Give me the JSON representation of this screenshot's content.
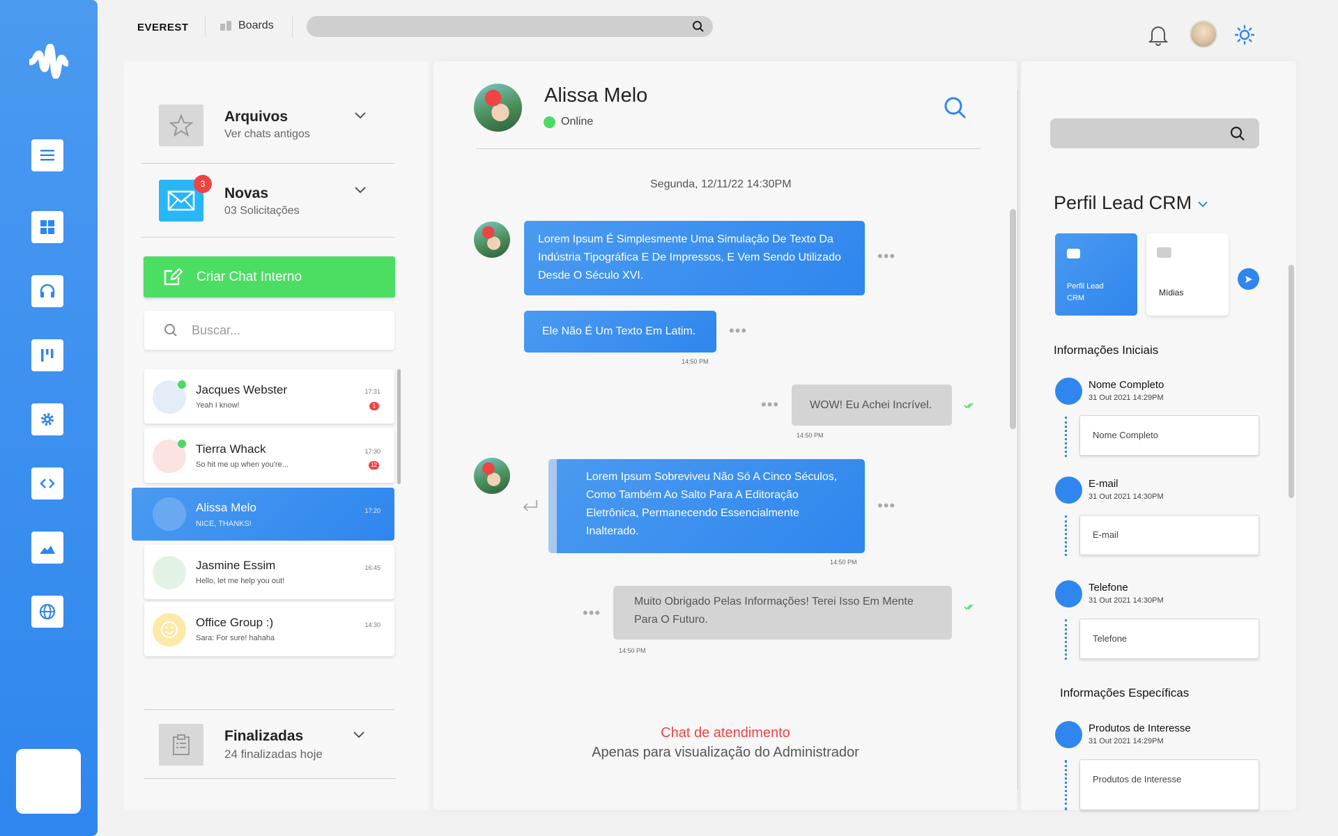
{
  "app": {
    "brand": "EVEREST",
    "boards_label": "Boards",
    "accent": "#2f86ee",
    "online_color": "#4cd964",
    "alert_color": "#ef4444",
    "create_color": "#4cdd63"
  },
  "rail": {
    "icons": [
      "menu-icon",
      "grid-icon",
      "headset-icon",
      "kanban-icon",
      "settings-icon",
      "code-icon",
      "image-icon",
      "globe-icon"
    ]
  },
  "sections": {
    "arquivos": {
      "title": "Arquivos",
      "subtitle": "Ver chats antigos"
    },
    "novas": {
      "title": "Novas",
      "subtitle": "03 Solicitações",
      "badge": "3"
    },
    "criar": {
      "label": "Criar Chat Interno"
    },
    "buscar": {
      "placeholder": "Buscar..."
    },
    "finalizadas": {
      "title": "Finalizadas",
      "subtitle": "24 finalizadas hoje"
    }
  },
  "chats": [
    {
      "name": "Jacques Webster",
      "preview": "Yeah I know!",
      "time": "17:31",
      "badge": "1"
    },
    {
      "name": "Tierra Whack",
      "preview": "So hit me up when you're...",
      "time": "17:30",
      "badge": "12"
    },
    {
      "name": "Alissa Melo",
      "preview": "NICE, THANKS!",
      "time": "17:20",
      "badge": ""
    },
    {
      "name": "Jasmine Essim",
      "preview": "Hello, let me help you out!",
      "time": "16:45",
      "badge": ""
    },
    {
      "name": "Office Group :)",
      "preview": "Sara: For sure! hahaha",
      "time": "14:30",
      "badge": ""
    }
  ],
  "conversation": {
    "contact": "Alissa Melo",
    "status": "Online",
    "date": "Segunda, 12/11/22 14:30PM",
    "messages": [
      {
        "text": "Lorem Ipsum É Simplesmente Uma Simulação De Texto Da Indústria Tipográfica E De Impressos, E Vem Sendo Utilizado Desde O Século XVI.",
        "time": ""
      },
      {
        "text": "Ele Não É Um Texto Em Latim.",
        "time": "14:50 PM"
      },
      {
        "text": "WOW! Eu Achei Incrível.",
        "time": "14:50 PM"
      },
      {
        "text": "Lorem Ipsum Sobreviveu Não Só A Cinco Séculos, Como Também Ao Salto Para A Editoração Eletrônica, Permanecendo Essencialmente Inalterado.",
        "time": "14:50 PM"
      },
      {
        "text": "Muito Obrigado Pelas Informações! Terei Isso Em Mente Para O Futuro.",
        "time": "14:50 PM"
      }
    ],
    "footer_title": "Chat de atendimento",
    "footer_sub": "Apenas para visualização do Administrador"
  },
  "crm": {
    "title": "Perfil Lead CRM",
    "tabs": [
      "Perfil Lead CRM",
      "Mídias"
    ],
    "section_initial": "Informações Iniciais",
    "section_specific": "Informações Específicas",
    "fields": [
      {
        "label": "Nome Completo",
        "date": "31 Out 2021  14:29PM",
        "placeholder": "Nome Completo"
      },
      {
        "label": "E-mail",
        "date": "31 Out 2021  14:30PM",
        "placeholder": "E-mail"
      },
      {
        "label": "Telefone",
        "date": "31 Out 2021  14:30PM",
        "placeholder": "Telefone"
      },
      {
        "label": "Produtos de Interesse",
        "date": "31 Out 2021  14:29PM",
        "placeholder": "Produtos de Interesse"
      }
    ]
  }
}
